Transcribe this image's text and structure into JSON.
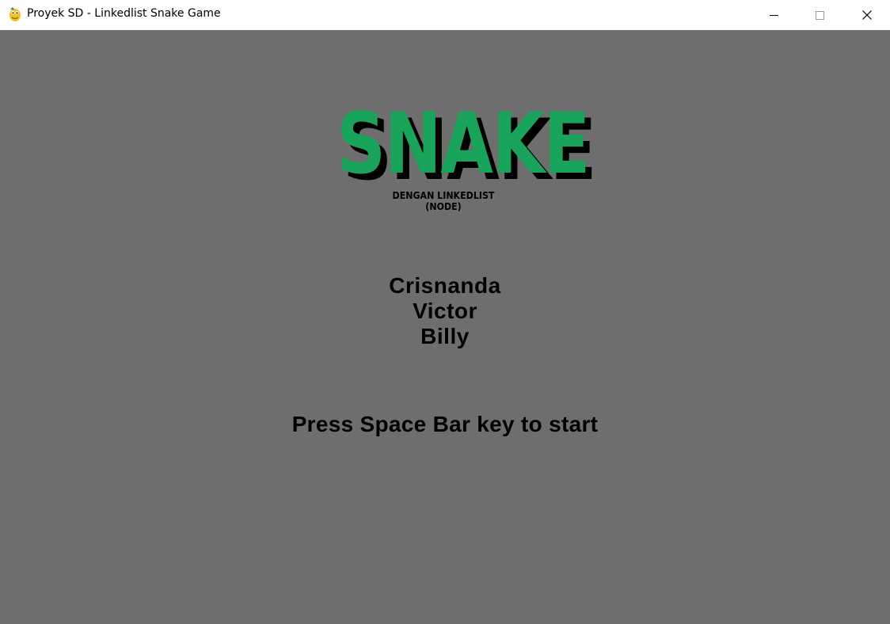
{
  "window": {
    "title": "Proyek SD - Linkedlist Snake Game",
    "icon": "pygame-snake-icon",
    "controls": [
      "minimize-icon",
      "maximize-icon",
      "close-icon"
    ]
  },
  "game": {
    "background_color": "#6e6e6e",
    "logo": {
      "title": "SNAKE",
      "subtitle": "DENGAN LINKEDLIST (NODE)",
      "title_color": "#1aa35a"
    },
    "credits": [
      "Crisnanda",
      "Victor",
      "Billy"
    ],
    "prompt": "Press Space Bar key to start"
  }
}
